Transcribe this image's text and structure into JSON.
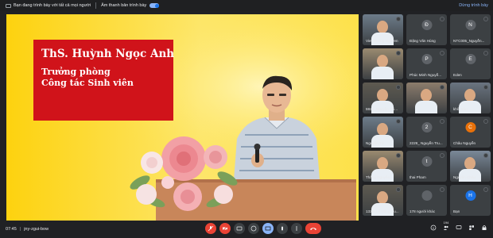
{
  "topbar": {
    "presenting_text": "Bạn đang trình bày với tất cả mọi người",
    "audio_text": "Âm thanh bản trình bày",
    "stop_text": "Dừng trình bày"
  },
  "slide": {
    "name": "ThS. Huỳnh Ngọc Anh",
    "role_line1": "Trưởng phòng",
    "role_line2": "Công tác Sinh viên"
  },
  "participants": [
    {
      "name": "Viet Truong Nguyen",
      "type": "photo"
    },
    {
      "name": "Đặng Văn Hùng",
      "type": "avatar",
      "initial": "Đ",
      "color": "#5f6368"
    },
    {
      "name": "NTC005_Nguyễn...",
      "type": "avatar",
      "initial": "N",
      "color": "#5f6368"
    },
    {
      "name": "",
      "type": "photo"
    },
    {
      "name": "Phúc Minh Nguyễ...",
      "type": "avatar",
      "initial": "P",
      "color": "#5f6368"
    },
    {
      "name": "Eden",
      "type": "avatar",
      "initial": "E",
      "color": "#5f6368"
    },
    {
      "name": "5921_Nguyễn Thi...",
      "type": "photo"
    },
    {
      "name": "",
      "type": "photo"
    },
    {
      "name": "khôi trần",
      "type": "photo"
    },
    {
      "name": "Nguyễn Tứ",
      "type": "photo"
    },
    {
      "name": "2229_ Nguyễn Tru...",
      "type": "avatar",
      "initial": "2",
      "color": "#5f6368"
    },
    {
      "name": "Châu Nguyễn",
      "type": "avatar",
      "initial": "C",
      "color": "#e8710a"
    },
    {
      "name": "Thắng Nguyễn",
      "type": "photo"
    },
    {
      "name": "thai Pham",
      "type": "avatar",
      "initial": "t",
      "color": "#5f6368"
    },
    {
      "name": "Nguyễn Châu",
      "type": "photo"
    },
    {
      "name": "1326- Lê Hồng Qu...",
      "type": "photo"
    },
    {
      "name": "178 người khác",
      "type": "avatar",
      "initial": "",
      "color": "#5f6368"
    },
    {
      "name": "Bạn",
      "type": "avatar",
      "initial": "H",
      "color": "#1a73e8"
    }
  ],
  "bottombar": {
    "time": "07:45",
    "separator": "|",
    "meeting_code": "jny-zgui-bow",
    "people_count": "194"
  },
  "colors": {
    "end_call": "#ea4335",
    "accent": "#8ab4f8"
  }
}
